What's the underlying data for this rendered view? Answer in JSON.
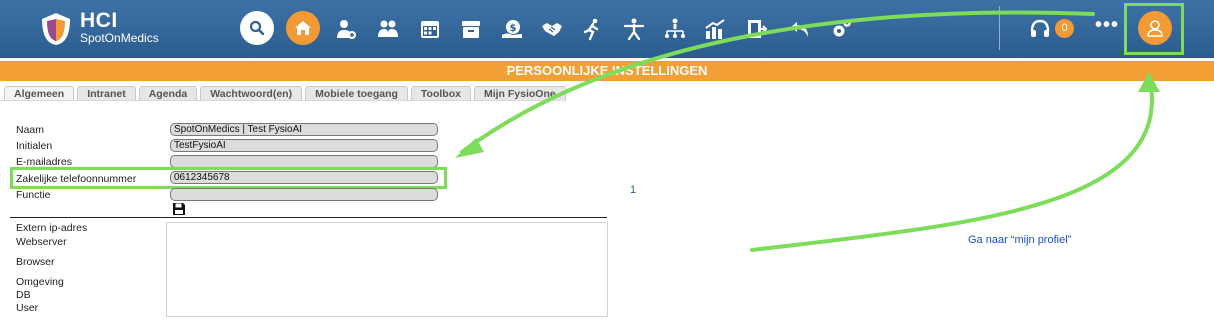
{
  "app": {
    "brand_name": "HCI",
    "brand_sub": "SpotOnMedics"
  },
  "toolbar": {
    "icons": [
      "search-icon",
      "home-icon",
      "add-user-icon",
      "users-icon",
      "calendar-icon",
      "archive-icon",
      "money-icon",
      "handshake-icon",
      "running-icon",
      "exercise-icon",
      "hierarchy-icon",
      "statistics-icon",
      "door-icon",
      "undo-icon",
      "settings-icon",
      "headset-icon",
      "more-icon",
      "profile-icon"
    ],
    "notification_count": "0",
    "more_label": "•••"
  },
  "page": {
    "title": "PERSOONLIJKE INSTELLINGEN"
  },
  "tabs": [
    {
      "label": "Algemeen"
    },
    {
      "label": "Intranet"
    },
    {
      "label": "Agenda"
    },
    {
      "label": "Wachtwoord(en)"
    },
    {
      "label": "Mobiele toegang"
    },
    {
      "label": "Toolbox"
    },
    {
      "label": "Mijn FysioOne"
    }
  ],
  "form": {
    "naam_label": "Naam",
    "naam_value": "SpotOnMedics | Test FysioAI",
    "initialen_label": "Initialen",
    "initialen_value": "TestFysioAI",
    "email_label": "E-mailadres",
    "email_value": "",
    "phone_label": "Zakelijke telefoonnummer",
    "phone_value": "0612345678",
    "functie_label": "Functie",
    "functie_value": ""
  },
  "info": {
    "labels": [
      "Extern ip-adres",
      "Webserver",
      "Browser",
      "Omgeving",
      "DB",
      "User"
    ]
  },
  "annotation": {
    "stray_mark": "1",
    "text": "Ga naar “mijn profiel”"
  },
  "colors": {
    "topbar": "#2f6196",
    "accent_orange": "#f39a34",
    "highlight_green": "#7ddc5a",
    "annotation_blue": "#1a4fd6"
  }
}
